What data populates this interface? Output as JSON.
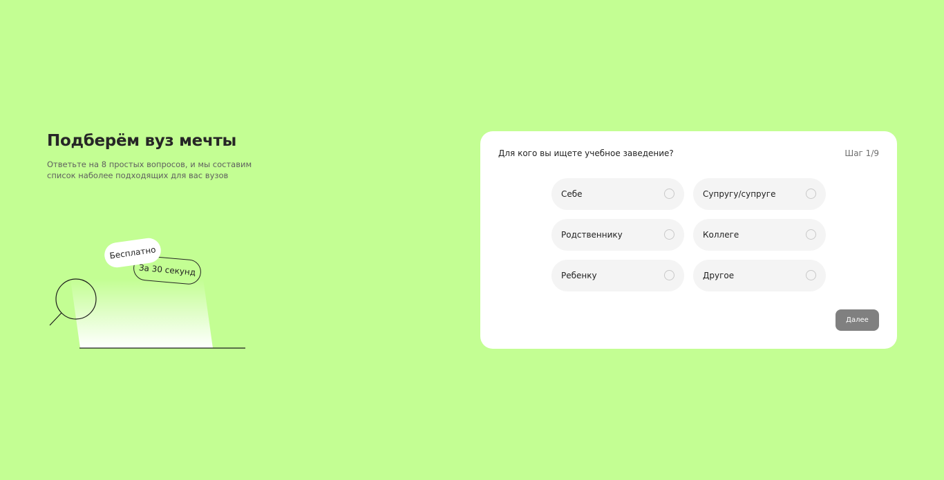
{
  "promo": {
    "title": "Подберём вуз мечты",
    "description": "Ответьте на 8 простых вопросов, и мы составим список наболее подходящих для вас вузов",
    "badge_free": "Бесплатно",
    "badge_fast": "За 30 секунд"
  },
  "quiz": {
    "question": "Для кого вы ищете учебное заведение?",
    "step": "Шаг 1/9",
    "options": [
      {
        "label": "Себе",
        "selected": false
      },
      {
        "label": "Супругу/супруге",
        "selected": false
      },
      {
        "label": "Родственнику",
        "selected": false
      },
      {
        "label": "Коллеге",
        "selected": false
      },
      {
        "label": "Ребенку",
        "selected": false
      },
      {
        "label": "Другое",
        "selected": false
      }
    ],
    "next_label": "Далее"
  },
  "colors": {
    "background": "#c3fe93",
    "card": "#ffffff",
    "option_bg": "#f4f4f4",
    "button_disabled": "#808080"
  },
  "icons": {
    "illustration": "magnifier-icon"
  }
}
